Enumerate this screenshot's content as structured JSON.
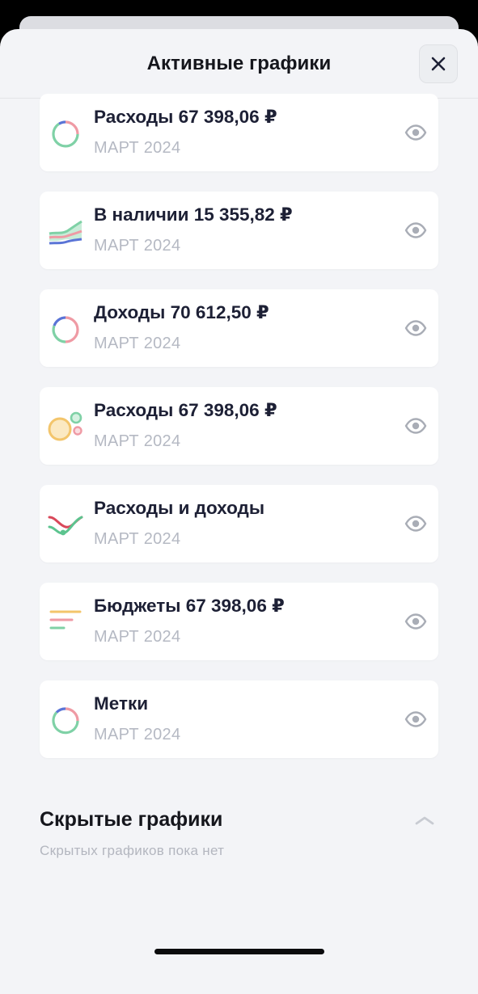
{
  "header": {
    "title": "Активные графики"
  },
  "charts": [
    {
      "title": "Расходы 67 398,06 ₽",
      "subtitle": "МАРТ 2024",
      "icon": "donut-chart-icon"
    },
    {
      "title": "В наличии 15 355,82 ₽",
      "subtitle": "МАРТ 2024",
      "icon": "stacked-area-chart-icon"
    },
    {
      "title": "Доходы 70 612,50 ₽",
      "subtitle": "МАРТ 2024",
      "icon": "donut-chart-icon"
    },
    {
      "title": "Расходы 67 398,06 ₽",
      "subtitle": "МАРТ 2024",
      "icon": "bubble-chart-icon"
    },
    {
      "title": "Расходы и доходы",
      "subtitle": "МАРТ 2024",
      "icon": "line-chart-icon"
    },
    {
      "title": "Бюджеты 67 398,06 ₽",
      "subtitle": "МАРТ 2024",
      "icon": "bar-list-icon"
    },
    {
      "title": "Метки",
      "subtitle": "МАРТ 2024",
      "icon": "donut-chart-icon"
    }
  ],
  "hidden": {
    "title": "Скрытые графики",
    "empty_text": "Скрытых графиков пока нет"
  },
  "colors": {
    "green": "#7fd1a6",
    "pink": "#ef9aa4",
    "blue": "#5a74d6",
    "yellow": "#f3c56b",
    "eye": "#a9adb6"
  }
}
